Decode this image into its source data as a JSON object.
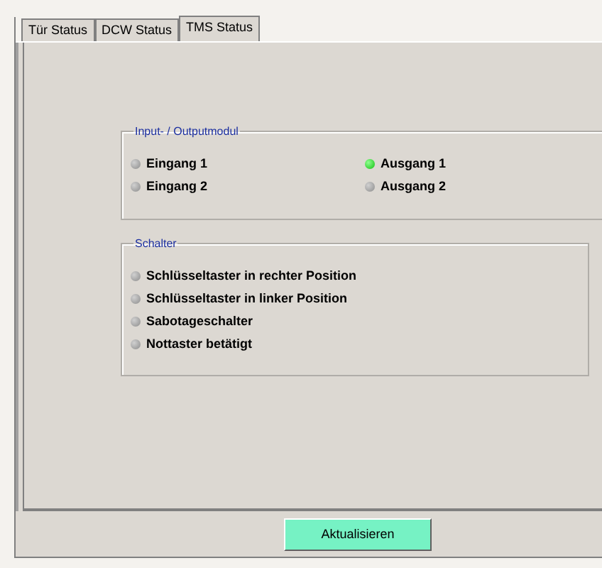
{
  "tabs": [
    {
      "label": "Tür Status",
      "selected": false
    },
    {
      "label": "DCW Status",
      "selected": false
    },
    {
      "label": "TMS Status",
      "selected": true
    }
  ],
  "io_group": {
    "title": "Input- / Outputmodul",
    "inputs": [
      {
        "label": "Eingang 1",
        "on": false
      },
      {
        "label": "Eingang 2",
        "on": false
      }
    ],
    "outputs": [
      {
        "label": "Ausgang 1",
        "on": true
      },
      {
        "label": "Ausgang 2",
        "on": false
      }
    ]
  },
  "switch_group": {
    "title": "Schalter",
    "items": [
      {
        "label": "Schlüsseltaster in rechter Position",
        "on": false
      },
      {
        "label": "Schlüsseltaster in linker Position",
        "on": false
      },
      {
        "label": "Sabotageschalter",
        "on": false
      },
      {
        "label": "Nottaster betätigt",
        "on": false
      }
    ]
  },
  "refresh_button": "Aktualisieren"
}
